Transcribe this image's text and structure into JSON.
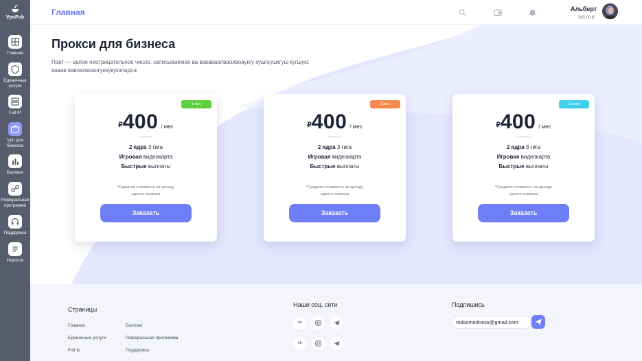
{
  "brand": {
    "name": "VpnPub"
  },
  "sidebar": {
    "items": [
      {
        "label": "Главная",
        "icon": "grid-icon"
      },
      {
        "label": "Единичные услуги",
        "icon": "shield-icon"
      },
      {
        "label": "Full IP",
        "icon": "server-icon"
      },
      {
        "label": "Vpn для бизнеса",
        "icon": "briefcase-icon",
        "active": true
      },
      {
        "label": "Биллинг",
        "icon": "bar-chart-icon"
      },
      {
        "label": "Реферальная программа",
        "icon": "share-icon"
      },
      {
        "label": "Поддержка",
        "icon": "headset-icon"
      },
      {
        "label": "Новости",
        "icon": "document-icon"
      }
    ]
  },
  "header": {
    "title": "Главная",
    "user_name": "Альберт",
    "user_balance": "360,00 ₽"
  },
  "main": {
    "title": "Прокси для бизнеса",
    "description_line1": "Порт — целое неотрицательное число, записываемое ва вававаолваолвоаукгу кушгкушкгуш кугшукг.",
    "description_line2": "вавав вавоалвоангункукукэпадпа"
  },
  "plans": [
    {
      "badge": "1 мес",
      "badge_color": "#5bd23b",
      "currency": "₽",
      "price": "400",
      "per": "/ мес",
      "f1_bold": "2 ядра",
      "f1_rest": " 3 гига",
      "f2_bold": "Игровая",
      "f2_rest": " видеокарта",
      "f3_bold": "Быстрые",
      "f3_rest": " выплаты",
      "note1": "*Средняя стоимость за аренду",
      "note2": "одного сервера",
      "button": "Заказать"
    },
    {
      "badge": "3 мес",
      "badge_color": "#f48a4e",
      "currency": "₽",
      "price": "400",
      "per": "/ мес",
      "f1_bold": "2 ядра",
      "f1_rest": " 3 гига",
      "f2_bold": "Игровая",
      "f2_rest": " видеокарта",
      "f3_bold": "Быстрые",
      "f3_rest": " выплаты",
      "note1": "*Средняя стоимость за аренду",
      "note2": "одного сервера",
      "button": "Заказать"
    },
    {
      "badge": "12 мес",
      "badge_color": "#3fd0ea",
      "currency": "₽",
      "price": "400",
      "per": "/ мес",
      "f1_bold": "2 ядра",
      "f1_rest": " 3 гига",
      "f2_bold": "Игровая",
      "f2_rest": " видеокарта",
      "f3_bold": "Быстрые",
      "f3_rest": " выплаты",
      "note1": "*Средняя стоимость за аренду",
      "note2": "одного сервера",
      "button": "Заказать"
    }
  ],
  "footer": {
    "pages_title": "Страницы",
    "links_col1": [
      "Главная",
      "Единичные услуги",
      "Full Ip"
    ],
    "links_col2": [
      "Биллинг",
      "Реферальная программа",
      "Поддержка"
    ],
    "social_title": "Наши соц. сети",
    "social_icons": [
      "vk-icon",
      "instagram-icon",
      "telegram-icon"
    ],
    "vk_label": "vk",
    "subscribe_title": "Подпишись",
    "email_value": "redssmedness@gmail.com"
  },
  "colors": {
    "accent": "#6e7ef5",
    "sidebar_bg": "#585d6e",
    "decor_light": "#e4e7fd",
    "decor_lighter": "#f0f1fe"
  }
}
